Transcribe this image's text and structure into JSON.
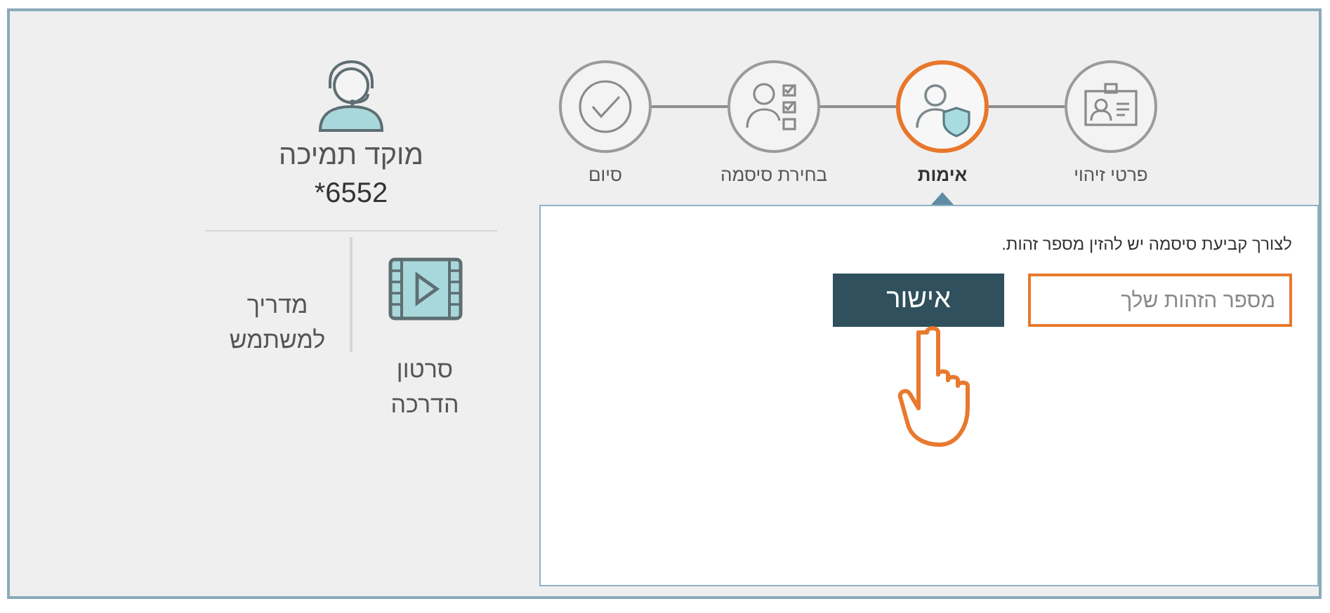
{
  "support": {
    "title": "מוקד תמיכה",
    "phone": "*6552"
  },
  "resources": [
    {
      "kind": "video",
      "label": "סרטון הדרכה"
    },
    {
      "kind": "guide",
      "label": "מדריך למשתמש"
    }
  ],
  "steps": [
    {
      "kind": "id-card",
      "label": "פרטי זיהוי",
      "selected": false
    },
    {
      "kind": "verify",
      "label": "אימות",
      "selected": true
    },
    {
      "kind": "password",
      "label": "בחירת סיסמה",
      "selected": false
    },
    {
      "kind": "done",
      "label": "סיום",
      "selected": false
    }
  ],
  "panel": {
    "instruction": "לצורך קביעת סיסמה יש להזין מספר זהות.",
    "id_field": {
      "placeholder": "מספר הזהות שלך"
    },
    "submit_button": "אישור"
  }
}
